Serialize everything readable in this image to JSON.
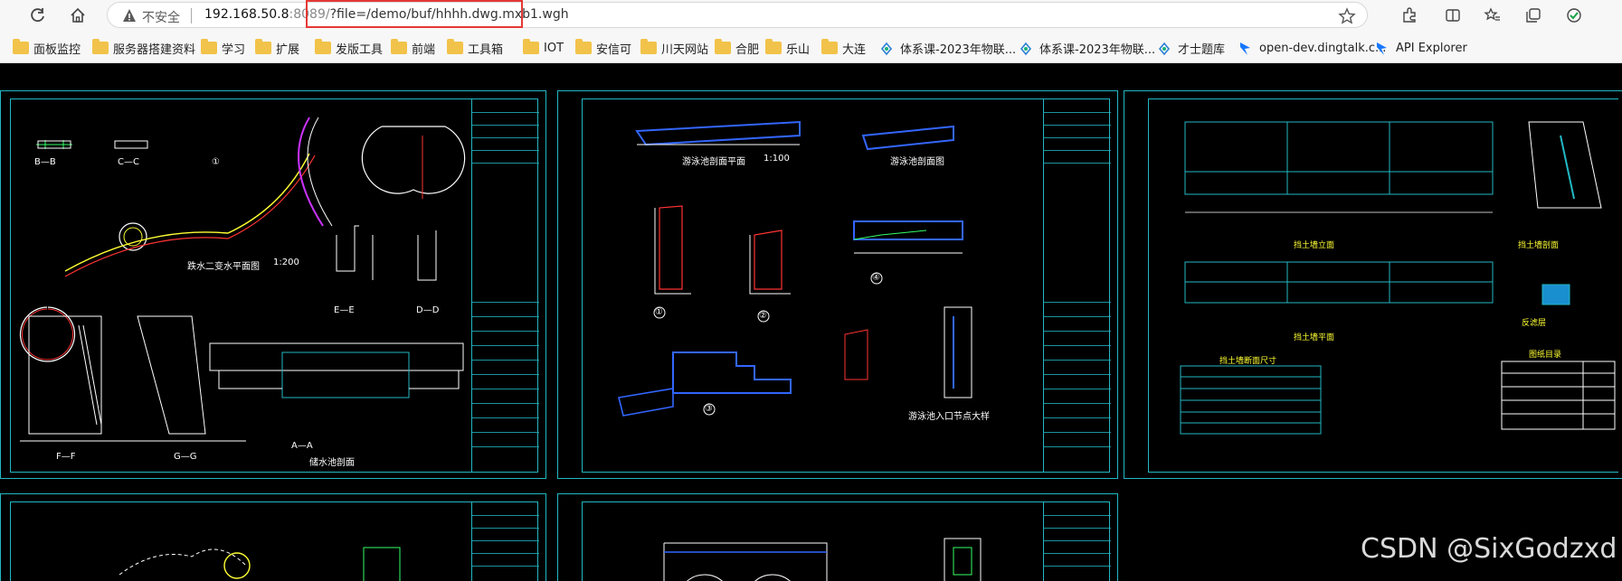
{
  "browser": {
    "insecure_label": "不安全",
    "url_host": "192.168.50.8",
    "url_port": ":8089/",
    "url_path": "?file=/demo/buf/hhhh.dwg.mxb1.wgh"
  },
  "bookmarks": [
    {
      "label": "面板监控",
      "icon": "folder-icon"
    },
    {
      "label": "服务器搭建资料",
      "icon": "folder-icon"
    },
    {
      "label": "学习",
      "icon": "folder-icon"
    },
    {
      "label": "扩展",
      "icon": "folder-icon"
    },
    {
      "label": "发版工具",
      "icon": "folder-icon"
    },
    {
      "label": "前端",
      "icon": "folder-icon"
    },
    {
      "label": "工具箱",
      "icon": "folder-icon"
    },
    {
      "label": "IOT",
      "icon": "folder-icon"
    },
    {
      "label": "安信可",
      "icon": "folder-icon"
    },
    {
      "label": "川天网站",
      "icon": "folder-icon"
    },
    {
      "label": "合肥",
      "icon": "folder-icon"
    },
    {
      "label": "乐山",
      "icon": "folder-icon"
    },
    {
      "label": "大连",
      "icon": "folder-icon"
    },
    {
      "label": "体系课-2023年物联...",
      "icon": "site-icon"
    },
    {
      "label": "体系课-2023年物联...",
      "icon": "site-icon"
    },
    {
      "label": "才士题库",
      "icon": "site-icon"
    },
    {
      "label": "open-dev.dingtalk.c...",
      "icon": "dingtalk-icon"
    },
    {
      "label": "API Explorer",
      "icon": "dingtalk-icon"
    }
  ],
  "drawing": {
    "sheet1": {
      "sections": [
        "B—B",
        "C—C",
        "①",
        "E—E",
        "D—D",
        "F—F",
        "G—G",
        "A—A"
      ],
      "caption_plan": "跌水二变水平面图",
      "caption_section": "储水池剖面",
      "scale": "1:200"
    },
    "sheet2": {
      "caption_plan": "游泳池剖面平面",
      "caption_detail": "游泳池剖面图",
      "caption_entry": "游泳池入口节点大样",
      "scale": "1:100",
      "markers": [
        "①",
        "②",
        "③",
        "④"
      ]
    },
    "sheet3": {
      "caption_elev": "挡土墙立面",
      "caption_plan": "挡土墙平面",
      "caption_section": "挡土墙剖面",
      "caption_detail": "反滤层",
      "table_title": "挡土墙断面尺寸",
      "catalog_title": "图纸目录"
    },
    "colors": {
      "frame": "#22b8c4",
      "accent_yellow": "#ffff33",
      "accent_green": "#33ff66"
    }
  },
  "watermark": "CSDN @SixGodzxd"
}
